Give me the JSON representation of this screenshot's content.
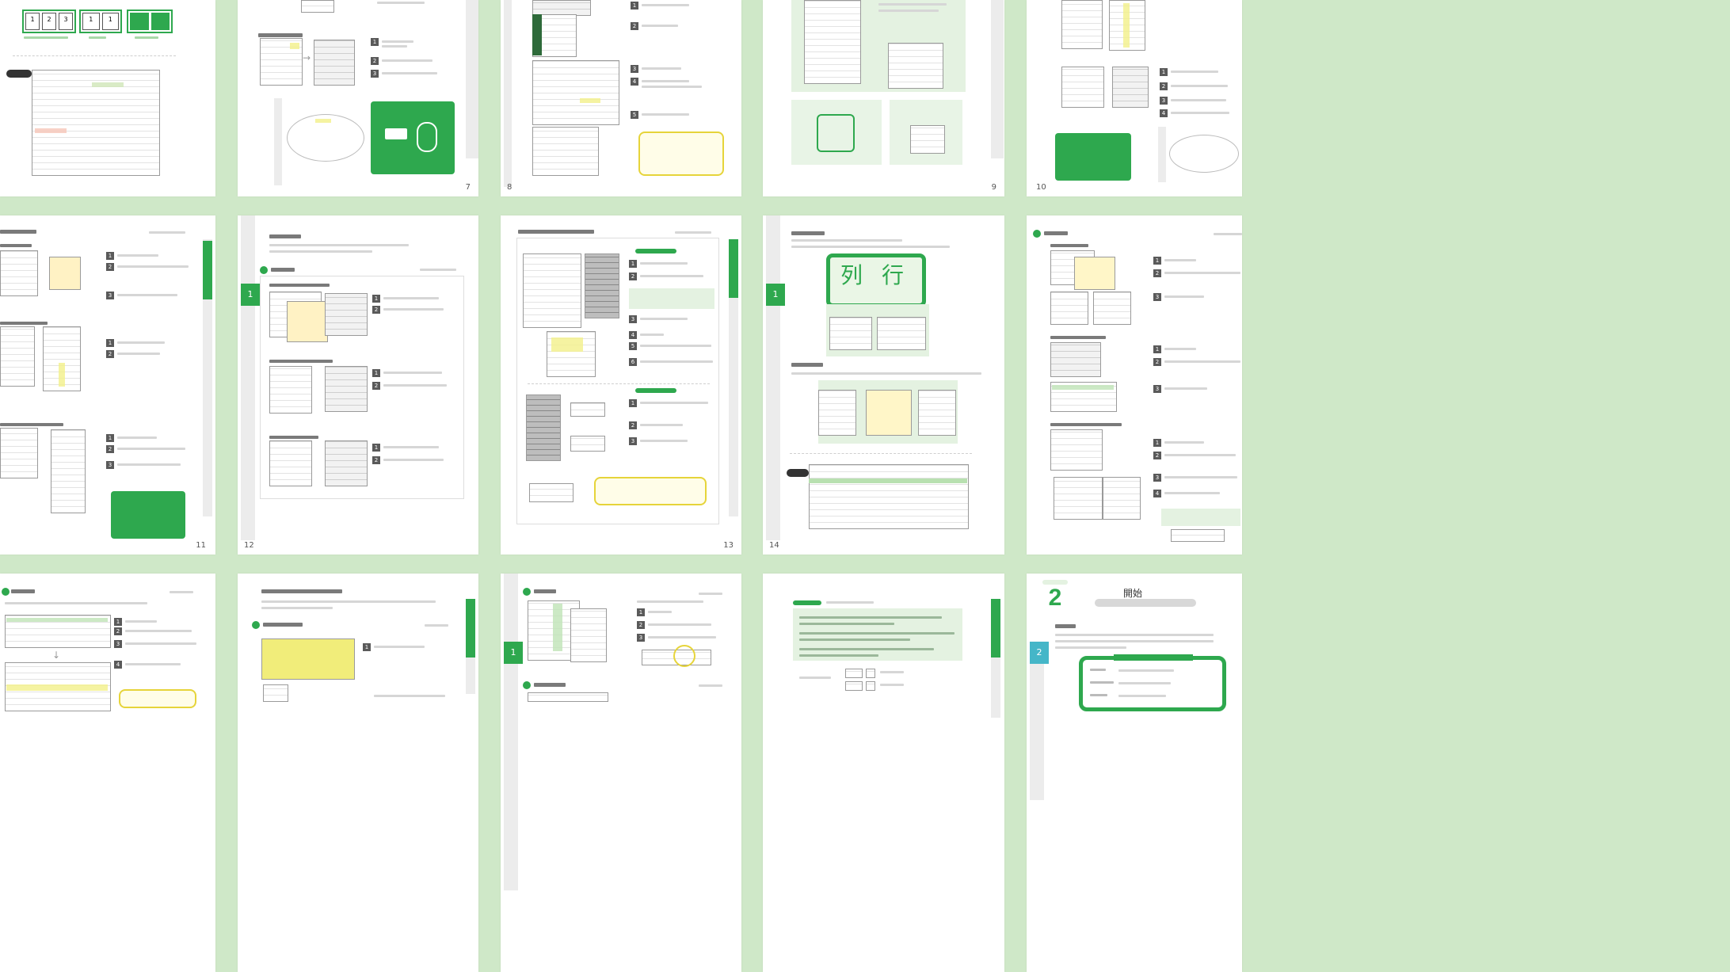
{
  "page_numbers": {
    "p7": "7",
    "p8": "8",
    "p9": "9",
    "p10": "10",
    "p11": "11",
    "p12": "12",
    "p13": "13",
    "p14": "14"
  },
  "section_tabs": {
    "s1a": "1",
    "s1b": "1",
    "s1c": "1",
    "s2": "2"
  },
  "row1": {
    "p6": {
      "cells_group1": [
        "1",
        "2",
        "3"
      ],
      "cells_group2": [
        "1",
        "1"
      ]
    }
  },
  "row2": {
    "p14": {
      "big_char_col": "列",
      "big_char_row": "行"
    }
  },
  "row3": {
    "p20": {
      "section_badge_number": "2",
      "heading": "開始"
    }
  },
  "colors": {
    "background": "#cfe8c8",
    "accent_green": "#2ea84e",
    "highlight_yellow": "#f3f08a",
    "tip_border": "#e6d43a"
  }
}
